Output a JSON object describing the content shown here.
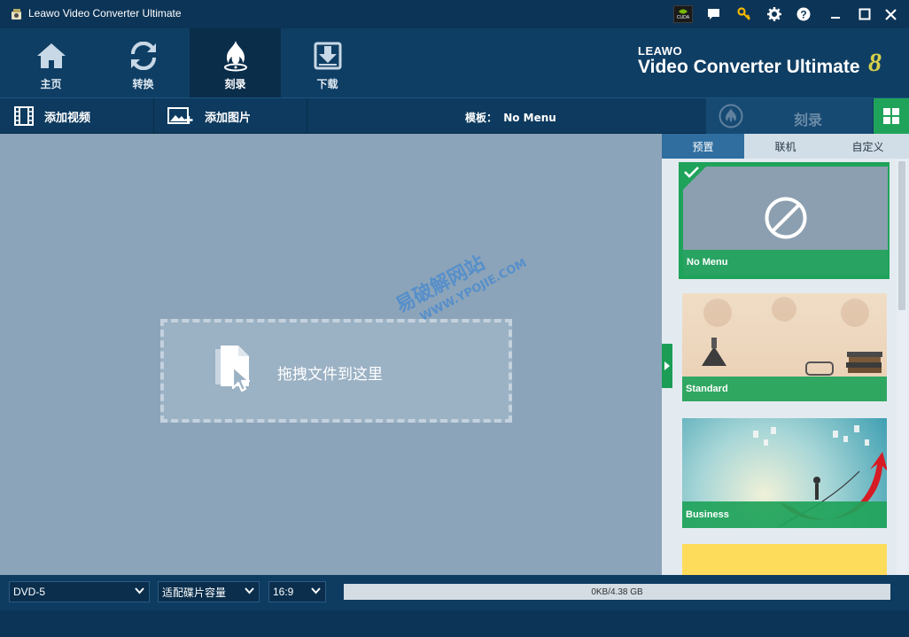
{
  "window": {
    "title": "Leawo Video Converter Ultimate",
    "cuda_badge": "CUDA"
  },
  "nav": {
    "items": [
      {
        "label": "主页",
        "icon": "home-icon"
      },
      {
        "label": "转换",
        "icon": "convert-icon"
      },
      {
        "label": "刻录",
        "icon": "burn-icon",
        "active": true
      },
      {
        "label": "下载",
        "icon": "download-icon"
      }
    ]
  },
  "brand": {
    "top": "LEAWO",
    "name": "Video Converter Ultimate",
    "version": "8"
  },
  "toolbar": {
    "add_video": "添加视频",
    "add_photo": "添加图片",
    "template_label": "模板：",
    "template_value": "No Menu",
    "burn_label": "刻录"
  },
  "main": {
    "drop_text": "拖拽文件到这里",
    "watermark_line1": "易破解网站",
    "watermark_line2": "WWW.YPOJIE.COM"
  },
  "panel": {
    "tabs": [
      "预置",
      "联机",
      "自定义"
    ],
    "templates": [
      {
        "name": "No Menu",
        "selected": true
      },
      {
        "name": "Standard"
      },
      {
        "name": "Business"
      },
      {
        "name": ""
      }
    ]
  },
  "bottom": {
    "disc_type": "DVD-5",
    "fit_mode": "适配碟片容量",
    "aspect_ratio": "16:9",
    "capacity": "0KB/4.38 GB"
  },
  "colors": {
    "accent_green": "#1fa35a",
    "nav_bg": "#0f3e64",
    "main_bg": "#8ca4b9"
  }
}
